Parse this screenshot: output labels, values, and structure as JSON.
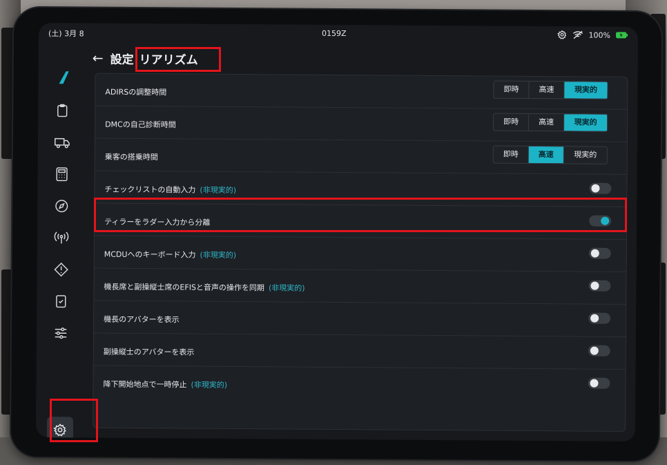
{
  "status_bar": {
    "date": "(土) 3月 8",
    "zulu_time": "0159Z",
    "battery": "100%"
  },
  "header": {
    "back_icon": "arrow-left-icon",
    "breadcrumb_parent": "設定",
    "title": "リアリズム"
  },
  "sidebar": {
    "items": [
      {
        "icon": "clipboard-icon"
      },
      {
        "icon": "truck-icon"
      },
      {
        "icon": "calculator-icon"
      },
      {
        "icon": "compass-icon"
      },
      {
        "icon": "antenna-icon"
      },
      {
        "icon": "warning-icon"
      },
      {
        "icon": "checklist-icon"
      },
      {
        "icon": "sliders-icon"
      }
    ],
    "settings_icon": "gear-icon"
  },
  "settings": {
    "segment_options": [
      "即時",
      "高速",
      "現実的"
    ],
    "rows": [
      {
        "label": "ADIRSの調整時間",
        "tag": "",
        "type": "segment",
        "selected": "現実的"
      },
      {
        "label": "DMCの自己診断時間",
        "tag": "",
        "type": "segment",
        "selected": "現実的"
      },
      {
        "label": "乗客の搭乗時間",
        "tag": "",
        "type": "segment",
        "selected": "高速"
      },
      {
        "label": "チェックリストの自動入力",
        "tag": "(非現実的)",
        "type": "toggle",
        "on": false
      },
      {
        "label": "ティラーをラダー入力から分離",
        "tag": "",
        "type": "toggle",
        "on": true
      },
      {
        "label": "MCDUへのキーボード入力",
        "tag": "(非現実的)",
        "type": "toggle",
        "on": false
      },
      {
        "label": "機長席と副操縦士席のEFISと音声の操作を同期",
        "tag": "(非現実的)",
        "type": "toggle",
        "on": false
      },
      {
        "label": "機長のアバターを表示",
        "tag": "",
        "type": "toggle",
        "on": false
      },
      {
        "label": "副操縦士のアバターを表示",
        "tag": "",
        "type": "toggle",
        "on": false
      },
      {
        "label": "降下開始地点で一時停止",
        "tag": "(非現実的)",
        "type": "toggle",
        "on": false
      }
    ]
  },
  "colors": {
    "accent": "#1db3c7",
    "highlight": "#e4141b"
  }
}
